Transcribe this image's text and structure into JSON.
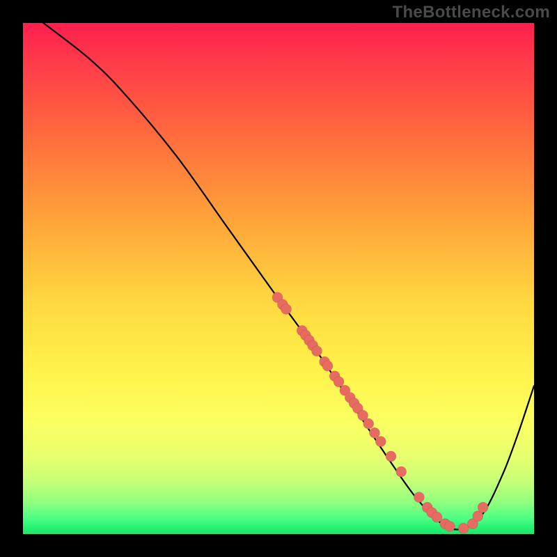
{
  "watermark": "TheBottleneck.com",
  "chart_data": {
    "type": "line",
    "title": "",
    "xlabel": "",
    "ylabel": "",
    "xlim": [
      0,
      1
    ],
    "ylim": [
      0,
      1
    ],
    "grid": false,
    "legend": false,
    "background_gradient": {
      "stops": [
        {
          "pos": 0.0,
          "color": "#ff1f4e"
        },
        {
          "pos": 0.22,
          "color": "#ff6b3d"
        },
        {
          "pos": 0.55,
          "color": "#ffd940"
        },
        {
          "pos": 0.78,
          "color": "#fbff62"
        },
        {
          "pos": 0.94,
          "color": "#8cff7e"
        },
        {
          "pos": 1.0,
          "color": "#1fe86c"
        }
      ]
    },
    "series": [
      {
        "name": "bottleneck-curve",
        "x": [
          0.04,
          0.13,
          0.2,
          0.3,
          0.4,
          0.5,
          0.58,
          0.66,
          0.72,
          0.77,
          0.82,
          0.86,
          0.9,
          0.94,
          0.97,
          1.0
        ],
        "y": [
          1.0,
          0.93,
          0.86,
          0.74,
          0.6,
          0.46,
          0.35,
          0.23,
          0.14,
          0.07,
          0.02,
          0.01,
          0.04,
          0.12,
          0.2,
          0.29
        ]
      }
    ],
    "annotations": [
      {
        "name": "highlight-points",
        "note": "clustered points along the curve (coral dots)",
        "points": [
          {
            "x": 0.498,
            "y": 0.463
          },
          {
            "x": 0.508,
            "y": 0.449
          },
          {
            "x": 0.515,
            "y": 0.44
          },
          {
            "x": 0.546,
            "y": 0.398
          },
          {
            "x": 0.553,
            "y": 0.389
          },
          {
            "x": 0.56,
            "y": 0.379
          },
          {
            "x": 0.567,
            "y": 0.369
          },
          {
            "x": 0.575,
            "y": 0.358
          },
          {
            "x": 0.59,
            "y": 0.337
          },
          {
            "x": 0.596,
            "y": 0.329
          },
          {
            "x": 0.61,
            "y": 0.309
          },
          {
            "x": 0.618,
            "y": 0.298
          },
          {
            "x": 0.63,
            "y": 0.281
          },
          {
            "x": 0.64,
            "y": 0.267
          },
          {
            "x": 0.648,
            "y": 0.256
          },
          {
            "x": 0.655,
            "y": 0.246
          },
          {
            "x": 0.665,
            "y": 0.232
          },
          {
            "x": 0.676,
            "y": 0.216
          },
          {
            "x": 0.688,
            "y": 0.198
          },
          {
            "x": 0.7,
            "y": 0.181
          },
          {
            "x": 0.72,
            "y": 0.152
          },
          {
            "x": 0.74,
            "y": 0.122
          },
          {
            "x": 0.775,
            "y": 0.072
          },
          {
            "x": 0.791,
            "y": 0.052
          },
          {
            "x": 0.8,
            "y": 0.042
          },
          {
            "x": 0.81,
            "y": 0.033
          },
          {
            "x": 0.826,
            "y": 0.02
          },
          {
            "x": 0.835,
            "y": 0.015
          },
          {
            "x": 0.862,
            "y": 0.011
          },
          {
            "x": 0.88,
            "y": 0.02
          },
          {
            "x": 0.89,
            "y": 0.035
          },
          {
            "x": 0.9,
            "y": 0.052
          }
        ]
      }
    ]
  }
}
